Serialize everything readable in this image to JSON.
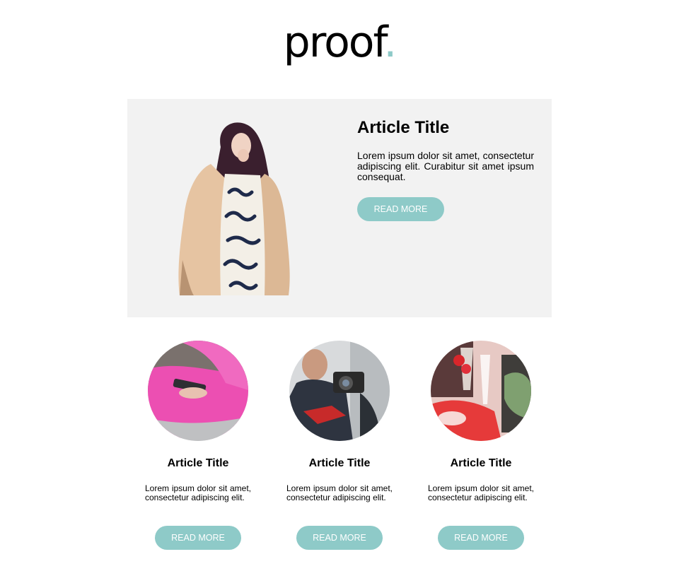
{
  "brand": {
    "name": "proof",
    "dot": "."
  },
  "colors": {
    "accent": "#8ecac8",
    "hero_bg": "#f2f2f2"
  },
  "hero": {
    "title": "Article Title",
    "text": "Lorem ipsum dolor sit amet, consectetur adipiscing elit. Curabitur sit amet ipsum consequat.",
    "button_label": "READ MORE",
    "image": "woman-in-beige-coat-photo"
  },
  "articles": [
    {
      "title": "Article Title",
      "text": "Lorem ipsum dolor sit amet, consectetur adipiscing elit.",
      "button_label": "READ MORE",
      "image": "hands-holding-phone-photo"
    },
    {
      "title": "Article Title",
      "text": "Lorem ipsum dolor sit amet, consectetur adipiscing elit.",
      "button_label": "READ MORE",
      "image": "photographer-with-camera-photo"
    },
    {
      "title": "Article Title",
      "text": "Lorem ipsum dolor sit amet, consectetur adipiscing elit.",
      "button_label": "READ MORE",
      "image": "champagne-and-strawberries-photo"
    }
  ]
}
